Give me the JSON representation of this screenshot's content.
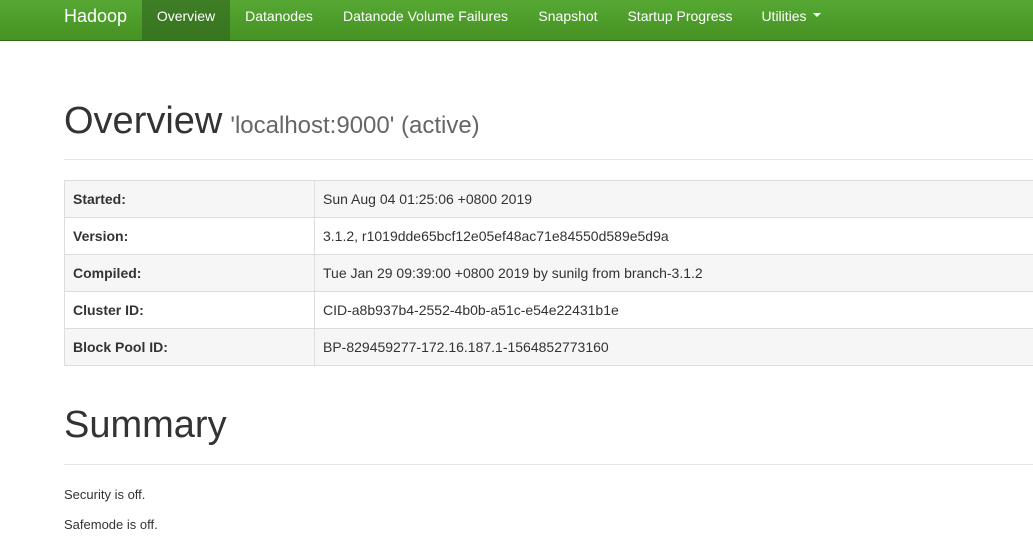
{
  "navbar": {
    "brand": "Hadoop",
    "items": [
      {
        "label": "Overview"
      },
      {
        "label": "Datanodes"
      },
      {
        "label": "Datanode Volume Failures"
      },
      {
        "label": "Snapshot"
      },
      {
        "label": "Startup Progress"
      },
      {
        "label": "Utilities"
      }
    ],
    "active_item": "Overview",
    "color": "#4c9a2a",
    "active_color": "#3a7a22"
  },
  "overview": {
    "title": "Overview",
    "subtitle": "'localhost:9000' (active)"
  },
  "info_table": {
    "rows": [
      {
        "label": "Started:",
        "value": "Sun Aug 04 01:25:06 +0800 2019"
      },
      {
        "label": "Version:",
        "value": "3.1.2, r1019dde65bcf12e05ef48ac71e84550d589e5d9a"
      },
      {
        "label": "Compiled:",
        "value": "Tue Jan 29 09:39:00 +0800 2019 by sunilg from branch-3.1.2"
      },
      {
        "label": "Cluster ID:",
        "value": "CID-a8b937b4-2552-4b0b-a51c-e54e22431b1e"
      },
      {
        "label": "Block Pool ID:",
        "value": "BP-829459277-172.16.187.1-1564852773160"
      }
    ]
  },
  "summary": {
    "title": "Summary",
    "security": "Security is off.",
    "safemode": "Safemode is off."
  }
}
